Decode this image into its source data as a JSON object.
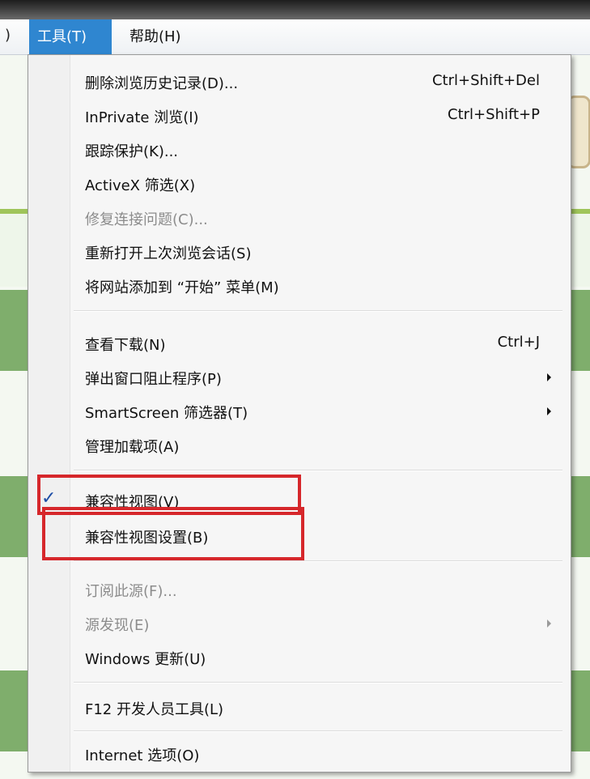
{
  "menubar": {
    "prev_fragment": ")",
    "tools_label": "工具(T)",
    "help_label": "帮助(H)"
  },
  "dropdown": {
    "items": [
      {
        "label": "删除浏览历史记录(D)...",
        "shortcut": "Ctrl+Shift+Del",
        "enabled": true
      },
      {
        "label": "InPrivate 浏览(I)",
        "shortcut": "Ctrl+Shift+P",
        "enabled": true
      },
      {
        "label": "跟踪保护(K)...",
        "shortcut": "",
        "enabled": true
      },
      {
        "label": "ActiveX 筛选(X)",
        "shortcut": "",
        "enabled": true
      },
      {
        "label": "修复连接问题(C)...",
        "shortcut": "",
        "enabled": false
      },
      {
        "label": "重新打开上次浏览会话(S)",
        "shortcut": "",
        "enabled": true
      },
      {
        "label": "将网站添加到 “开始” 菜单(M)",
        "shortcut": "",
        "enabled": true
      },
      {
        "label": "查看下载(N)",
        "shortcut": "Ctrl+J",
        "enabled": true
      },
      {
        "label": "弹出窗口阻止程序(P)",
        "shortcut": "",
        "enabled": true,
        "submenu": true
      },
      {
        "label": "SmartScreen 筛选器(T)",
        "shortcut": "",
        "enabled": true,
        "submenu": true
      },
      {
        "label": "管理加载项(A)",
        "shortcut": "",
        "enabled": true
      },
      {
        "label": "兼容性视图(V)",
        "shortcut": "",
        "enabled": true,
        "checked": true,
        "check_glyph": "✓"
      },
      {
        "label": "兼容性视图设置(B)",
        "shortcut": "",
        "enabled": true
      },
      {
        "label": "订阅此源(F)...",
        "shortcut": "",
        "enabled": false
      },
      {
        "label": "源发现(E)",
        "shortcut": "",
        "enabled": false,
        "submenu": true
      },
      {
        "label": "Windows 更新(U)",
        "shortcut": "",
        "enabled": true
      },
      {
        "label": "F12 开发人员工具(L)",
        "shortcut": "",
        "enabled": true
      },
      {
        "label": "Internet 选项(O)",
        "shortcut": "",
        "enabled": true
      }
    ]
  },
  "colors": {
    "menu_highlight": "#2f86d0",
    "annotation_box": "#d6272b",
    "check_mark": "#1c4da6"
  }
}
